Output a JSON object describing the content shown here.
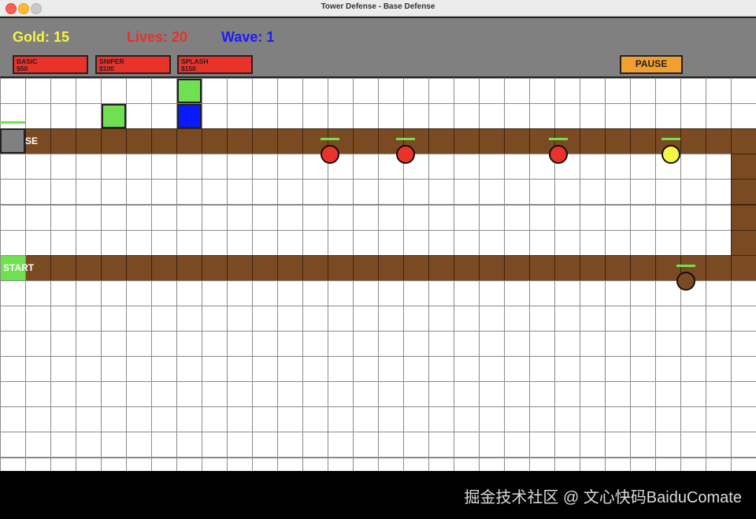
{
  "window": {
    "title": "Tower Defense - Base Defense"
  },
  "hud": {
    "gold": "Gold: 15",
    "lives": "Lives: 20",
    "wave": "Wave: 1",
    "colors": {
      "gold": "#f5f542",
      "lives": "#e8322a",
      "wave": "#1a1aff"
    },
    "towers": [
      {
        "name": "BASIC",
        "cost": "$50"
      },
      {
        "name": "SNIPER",
        "cost": "$100"
      },
      {
        "name": "SPLASH",
        "cost": "$150"
      }
    ],
    "pause_label": "PAUSE"
  },
  "board": {
    "start_label": "START",
    "base_label": "SE",
    "colors": {
      "path": "#7a4a23",
      "start": "#6fe04f",
      "base": "#808080"
    },
    "placed_towers": [
      {
        "type": "basic",
        "color": "#6fe04f"
      },
      {
        "type": "basic",
        "color": "#6fe04f"
      },
      {
        "type": "sniper",
        "color": "#0a1aff"
      }
    ],
    "enemies": [
      {
        "color": "#e8322a"
      },
      {
        "color": "#e8322a"
      },
      {
        "color": "#e8322a"
      },
      {
        "color": "#f5f542"
      },
      {
        "color": "#7a4a23"
      }
    ]
  },
  "watermark": "掘金技术社区 @ 文心快码BaiduComate"
}
